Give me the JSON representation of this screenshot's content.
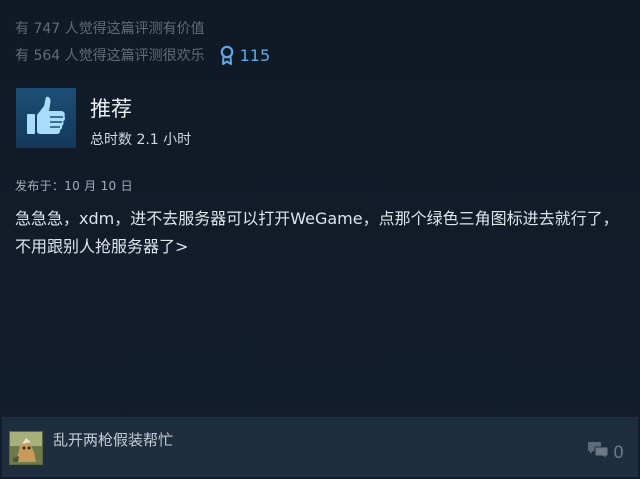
{
  "review": {
    "helpful_text": "有 747 人觉得这篇评测有价值",
    "funny_text": "有 564 人觉得这篇评测很欢乐",
    "award_count": "115",
    "recommendation": "推荐",
    "hours_on_record": "总时数 2.1 小时",
    "posted_date": "发布于：10 月 10 日",
    "body": "急急急，xdm，进不去服务器可以打开WeGame，点那个绿色三角图标进去就行了，不用跟别人抢服务器了>"
  },
  "author": {
    "name": "乱开两枪假装帮忙",
    "comment_count": "0"
  },
  "colors": {
    "background": "#101a26",
    "footer": "#1f2e3f",
    "award_blue": "#5fa9e6",
    "thumb_box": "#1d4f76",
    "thumb_icon": "#a9dcf8"
  },
  "icons": {
    "award": "award-ribbon-icon",
    "recommendation": "thumbs-up-icon",
    "comments": "comment-bubbles-icon"
  }
}
